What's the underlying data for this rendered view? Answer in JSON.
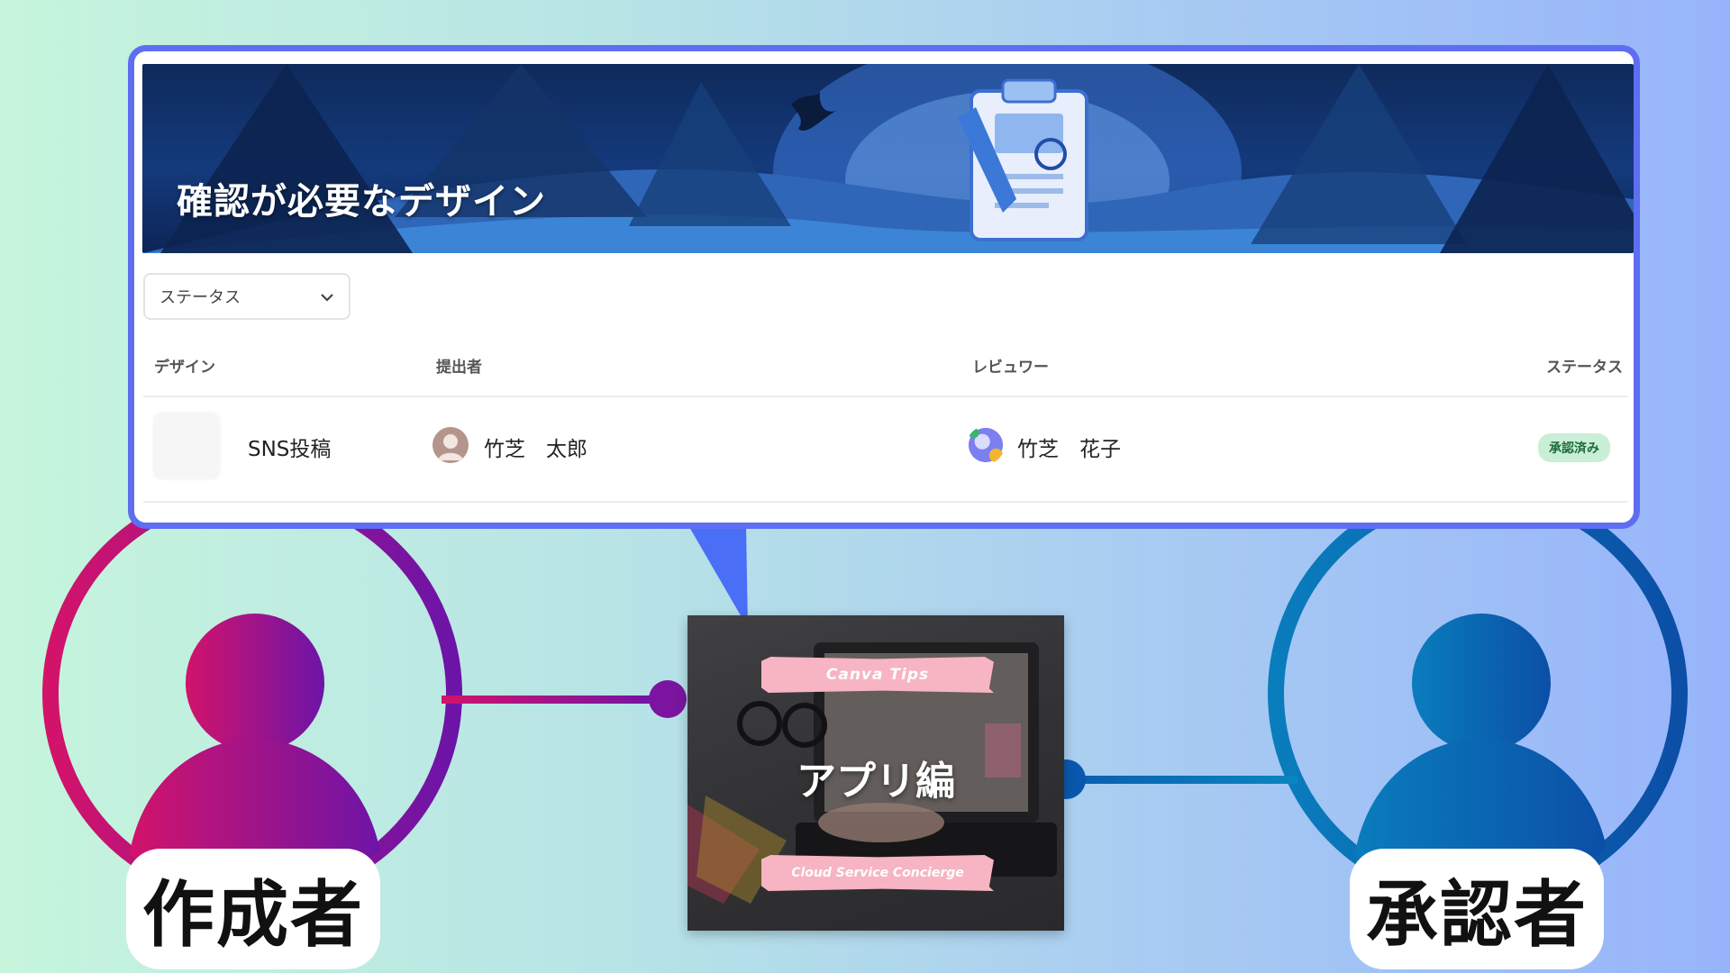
{
  "panel": {
    "banner_title": "確認が必要なデザイン",
    "filter": {
      "label": "ステータス"
    },
    "columns": [
      "デザイン",
      "提出者",
      "レビュワー",
      "ステータス"
    ],
    "rows": [
      {
        "design": "SNS投稿",
        "submitter": "竹芝　太郎",
        "reviewer": "竹芝　花子",
        "status": "承認済み"
      }
    ]
  },
  "center_card": {
    "tag_top": "Canva Tips",
    "title": "アプリ編",
    "tag_bottom": "Cloud Service Concierge"
  },
  "roles": {
    "creator": "作成者",
    "approver": "承認者"
  },
  "colors": {
    "creator_gradient_start": "#d3136a",
    "creator_gradient_end": "#6c14a8",
    "approver_gradient_start": "#0a7dbd",
    "approver_gradient_end": "#0b4fa6",
    "panel_border": "#5f6ef0",
    "approved_badge": "#c9efd6"
  }
}
